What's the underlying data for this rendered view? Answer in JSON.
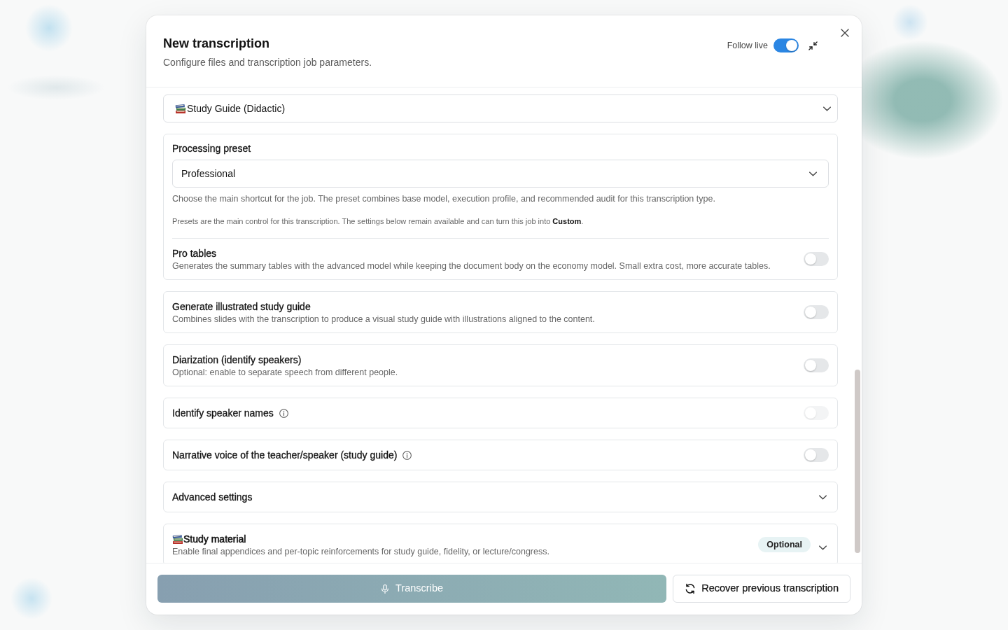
{
  "dialog": {
    "title": "New transcription",
    "subtitle": "Configure files and transcription job parameters.",
    "follow_live": {
      "label": "Follow live",
      "on": true
    }
  },
  "document_type": {
    "value": "Study Guide (Didactic)"
  },
  "preset": {
    "label": "Processing preset",
    "value": "Professional",
    "help": "Choose the main shortcut for the job. The preset combines base model, execution profile, and recommended audit for this transcription type.",
    "note": "Presets are the main control for this transcription. The settings below remain available and can turn this job into **Custom**.",
    "option": {
      "title": "Pro tables",
      "description": "Generates the summary tables with the advanced model while keeping the document body on the economy model. Small extra cost, more accurate tables.",
      "on": false
    }
  },
  "options": [
    {
      "kind": "toggle",
      "title": "Generate illustrated study guide",
      "description": "Combines slides with the transcription to produce a visual study guide with illustrations aligned to the content.",
      "info": false,
      "on": false,
      "disabled": false
    },
    {
      "kind": "toggle",
      "title": "Diarization (identify speakers)",
      "description": "Optional: enable to separate speech from different people.",
      "info": false,
      "on": false,
      "disabled": false
    },
    {
      "kind": "toggle",
      "title": "Identify speaker names",
      "info": true,
      "on": false,
      "disabled": true
    },
    {
      "kind": "toggle",
      "title": "Narrative voice of the teacher/speaker (study guide)",
      "info": true,
      "on": false,
      "disabled": false
    },
    {
      "kind": "expander",
      "title": "Advanced settings",
      "icon": false,
      "expanded": false
    },
    {
      "kind": "expander",
      "title": "Study material",
      "icon": true,
      "description": "Enable final appendices and per-topic reinforcements for study guide, fidelity, or lecture/congress.",
      "badge": "Optional",
      "expanded": false
    }
  ],
  "actions": [
    {
      "kind": "primary",
      "label": "Transcribe",
      "disabled": true
    },
    {
      "kind": "secondary",
      "label": "Recover previous transcription"
    }
  ]
}
